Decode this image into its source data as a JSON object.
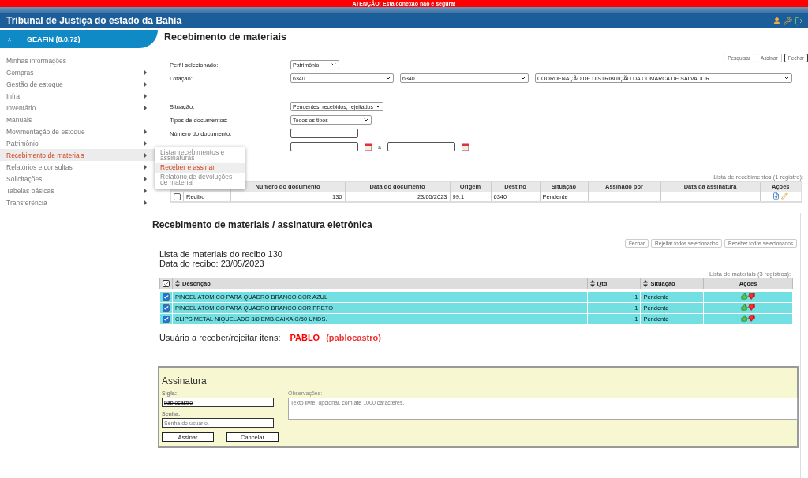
{
  "alert": "ATENÇÃO: Esta conexão não é segura!",
  "app_title": "Tribunal de Justiça do estado da Bahia",
  "sidebar": {
    "header": "GEAFIN (8.0.72)",
    "items": [
      {
        "label": "Minhas informações",
        "has_submenu": false,
        "selected": false
      },
      {
        "label": "Compras",
        "has_submenu": true,
        "selected": false
      },
      {
        "label": "Gestão de estoque",
        "has_submenu": true,
        "selected": false
      },
      {
        "label": "Infra",
        "has_submenu": true,
        "selected": false
      },
      {
        "label": "Inventário",
        "has_submenu": true,
        "selected": false
      },
      {
        "label": "Manuais",
        "has_submenu": false,
        "selected": false
      },
      {
        "label": "Movimentação de estoque",
        "has_submenu": true,
        "selected": false
      },
      {
        "label": "Patrimônio",
        "has_submenu": true,
        "selected": false
      },
      {
        "label": "Recebimento de materiais",
        "has_submenu": true,
        "selected": true
      },
      {
        "label": "Relatórios e consultas",
        "has_submenu": true,
        "selected": false
      },
      {
        "label": "Solicitações",
        "has_submenu": true,
        "selected": false
      },
      {
        "label": "Tabelas básicas",
        "has_submenu": true,
        "selected": false
      },
      {
        "label": "Transferência",
        "has_submenu": true,
        "selected": false
      }
    ],
    "submenu": [
      {
        "label": "Listar recebimentos e assinaturas",
        "selected": false
      },
      {
        "label": "Receber e assinar",
        "selected": true
      },
      {
        "label": "Relatório de devoluções de material",
        "selected": false
      }
    ]
  },
  "page_title": "Recebimento de materiais",
  "top_buttons": [
    "Pesquisar",
    "Assinar",
    "Fechar"
  ],
  "form": {
    "perfil": {
      "label": "Perfil selecionado:",
      "value": "Patrimônio"
    },
    "lotacao": {
      "label": "Lotação:",
      "values": [
        "6340",
        "6340",
        "COORDENAÇÃO DE DISTRIBUIÇÃO DA COMARCA DE SALVADOR"
      ]
    },
    "situacao": {
      "label": "Situação:",
      "value": "Pendentes, recebidos, rejeitados"
    },
    "tipos": {
      "label": "Tipos de documentos:",
      "value": "Todos os tipos"
    },
    "numero": {
      "label": "Número do documento:"
    },
    "date_separator": "a"
  },
  "receipts": {
    "caption": "Lista de recebimentos (1 registro):",
    "columns": [
      "Número do documento",
      "Data do documento",
      "Origem",
      "Destino",
      "Situação",
      "Assinado por",
      "Data da assinatura",
      "Ações"
    ],
    "rows": [
      {
        "checked": false,
        "type": "Recibo",
        "number": "130",
        "date": "23/05/2023",
        "origin": "99.1",
        "destination": "6340",
        "status": "Pendente"
      }
    ]
  },
  "dialog": {
    "title": "Recebimento de materiais / assinatura eletrônica",
    "buttons": [
      "Fechar",
      "Rejeitar todos selecionados",
      "Receber todos selecionados"
    ],
    "info": [
      "Lista de materiais do recibo 130",
      "Data do recibo: 23/05/2023"
    ],
    "caption": "Lista de materiais (3 registros):",
    "all_checked": true,
    "columns": [
      "Descrição",
      "Qtd",
      "Situação",
      "Ações"
    ],
    "rows": [
      {
        "checked": true,
        "description": "PINCEL ATOMICO PARA QUADRO BRANCO COR AZUL",
        "qty": "1",
        "status": "Pendente"
      },
      {
        "checked": true,
        "description": "PINCEL ATOMICO PARA QUADRO BRANCO COR PRETO",
        "qty": "1",
        "status": "Pendente"
      },
      {
        "checked": true,
        "description": "CLIPS METAL NIQUELADO 3/0 EMB.CAIXA C/50 UNDS.",
        "qty": "1",
        "status": "Pendente"
      }
    ],
    "user_label": "Usuário a receber/rejeitar itens:",
    "user_name": "PABLO",
    "user_login": "(pablocastro)",
    "signature": {
      "title": "Assinatura",
      "sigla_label": "Sigla:",
      "sigla_value": "pablocastro",
      "senha_label": "Senha:",
      "senha_placeholder": "Senha do usuário.",
      "obs_label": "Observações:",
      "obs_placeholder": "Texto livre, opcional, com até 1000 caracteres.",
      "buttons": [
        "Assinar",
        "Cancelar"
      ]
    }
  }
}
